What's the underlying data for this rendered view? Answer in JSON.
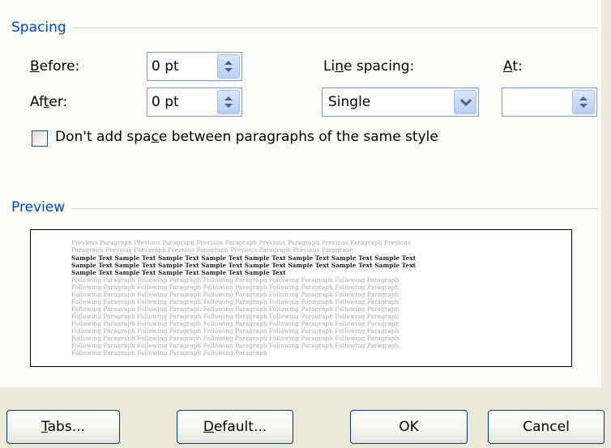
{
  "spacing": {
    "title": "Spacing",
    "before_label": "Before:",
    "before_value": "0 pt",
    "after_label": "After:",
    "after_value": "0 pt",
    "line_spacing_label": "Line spacing:",
    "line_spacing_value": "Single",
    "at_label": "At:",
    "at_value": "",
    "checkbox_label": "Don't add space between paragraphs of the same style",
    "checkbox_checked": false
  },
  "preview": {
    "title": "Preview",
    "previous_lines": [
      "Previous Paragraph Previous Paragraph Previous Paragraph Previous Paragraph Previous Paragraph Previous",
      "Paragraph Previous Paragraph Previous Paragraph Previous Paragraph Previous Paragraph"
    ],
    "sample_lines": [
      "Sample Text Sample Text Sample Text Sample Text Sample Text Sample Text Sample Text Sample Text",
      "Sample Text Sample Text Sample Text Sample Text Sample Text Sample Text Sample Text Sample Text",
      "Sample Text Sample Text Sample Text Sample Text Sample Text"
    ],
    "following_lines": [
      "Following Paragraph Following Paragraph Following Paragraph Following Paragraph Following Paragraph",
      "Following Paragraph Following Paragraph Following Paragraph Following Paragraph Following Paragraph",
      "Following Paragraph Following Paragraph Following Paragraph Following Paragraph Following Paragraph",
      "Following Paragraph Following Paragraph Following Paragraph Following Paragraph Following Paragraph",
      "Following Paragraph Following Paragraph Following Paragraph Following Paragraph Following Paragraph",
      "Following Paragraph Following Paragraph Following Paragraph Following Paragraph Following Paragraph",
      "Following Paragraph Following Paragraph Following Paragraph Following Paragraph Following Paragraph",
      "Following Paragraph Following Paragraph Following Paragraph Following Paragraph Following Paragraph",
      "Following Paragraph Following Paragraph Following Paragraph Following Paragraph Following Paragraph",
      "Following Paragraph Following Paragraph Following Paragraph Following Paragraph Following Paragraph",
      "Following Paragraph Following Paragraph Following Paragraph"
    ]
  },
  "buttons": {
    "tabs": "Tabs...",
    "default": "Default...",
    "ok": "OK",
    "cancel": "Cancel"
  },
  "colors": {
    "group_title": "#0046d5",
    "dialog_bg": "#ece9d8",
    "panel_bg": "#fbfbf7",
    "field_border": "#7f9db9"
  },
  "icons": {
    "spin": "spin-updown-icon",
    "dropdown": "chevron-down-icon"
  }
}
